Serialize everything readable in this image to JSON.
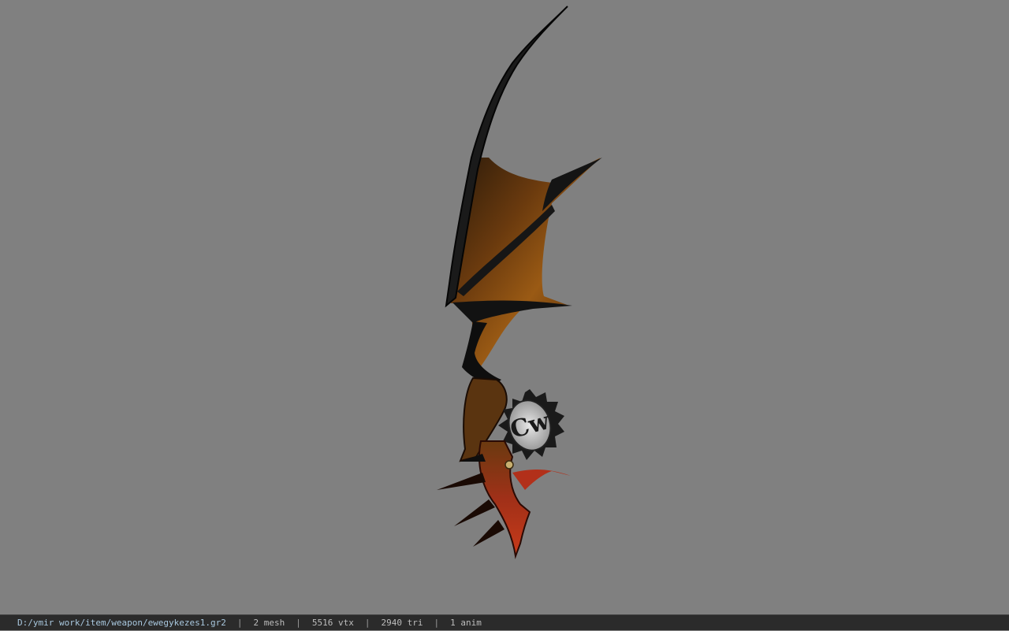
{
  "viewport": {
    "background_color": "#808080",
    "model": {
      "description_icon": "dragon-wing-sword-model",
      "emblem_text": "Cw"
    }
  },
  "status": {
    "file_path": "D:/ymir work/item/weapon/ewegykezes1.gr2",
    "separator": "|",
    "mesh": "2 mesh",
    "vertices": "5516 vtx",
    "triangles": "2940 tri",
    "animations": "1 anim"
  },
  "colors": {
    "status_bg": "#2b2b2b",
    "path_text": "#a9c8df",
    "stat_text": "#bdbdbd"
  }
}
